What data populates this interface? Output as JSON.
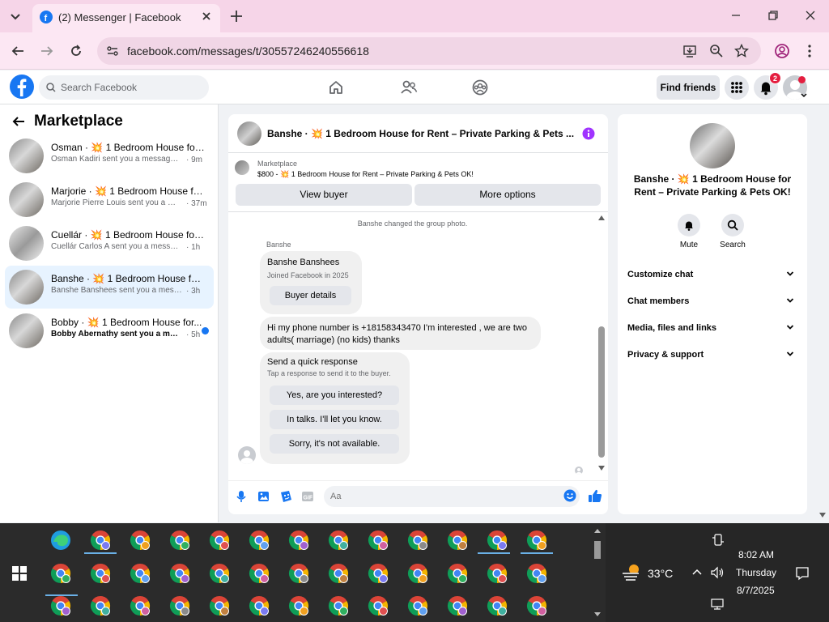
{
  "browser": {
    "tab_title": "(2) Messenger | Facebook",
    "url": "facebook.com/messages/t/30557246240556618"
  },
  "fbnav": {
    "search_placeholder": "Search Facebook",
    "find_friends": "Find friends",
    "notification_count": "2"
  },
  "sidebar": {
    "title": "Marketplace",
    "conversations": [
      {
        "name": "Osman · 💥 1 Bedroom House for ...",
        "preview": "Osman Kadiri sent you a message ab...",
        "time": "· 9m"
      },
      {
        "name": "Marjorie · 💥 1 Bedroom House for...",
        "preview": "Marjorie Pierre Louis sent you a mes...",
        "time": "· 37m"
      },
      {
        "name": "Cuellár · 💥 1 Bedroom House for ...",
        "preview": "Cuellár Carlos A sent you a message ...",
        "time": "· 1h"
      },
      {
        "name": "Banshe · 💥 1 Bedroom House for ...",
        "preview": "Banshe Banshees sent you a message ...",
        "time": "· 3h"
      },
      {
        "name": "Bobby · 💥 1 Bedroom House for...",
        "preview": "Bobby Abernathy sent you a mess...",
        "time": "· 5h"
      }
    ]
  },
  "chat": {
    "header_title": "Banshe · 💥 1 Bedroom House for Rent – Private Parking & Pets ...",
    "listing_label": "Marketplace",
    "listing_price": "$800 - 💥 1 Bedroom House for Rent – Private Parking & Pets OK!",
    "view_buyer": "View buyer",
    "more_options": "More options",
    "system_message": "Banshe changed the group photo.",
    "sender_name": "Banshe",
    "profile_card": {
      "name": "Banshe Banshees",
      "joined": "Joined Facebook in 2025",
      "button": "Buyer details"
    },
    "message_text": "Hi my phone number is +18158343470 I'm interested , we are two adults( marriage) (no kids) thanks",
    "quick_response": {
      "title": "Send a quick response",
      "subtitle": "Tap a response to send it to the buyer.",
      "options": [
        "Yes, are you interested?",
        "In talks. I'll let you know.",
        "Sorry, it's not available."
      ]
    },
    "input_placeholder": "Aa"
  },
  "info_panel": {
    "name": "Banshe · 💥 1 Bedroom House for Rent – Private Parking & Pets OK!",
    "mute": "Mute",
    "search": "Search",
    "sections": [
      "Customize chat",
      "Chat members",
      "Media, files and links",
      "Privacy & support"
    ]
  },
  "taskbar": {
    "temperature": "33°C",
    "time": "8:02 AM",
    "day": "Thursday",
    "date": "8/7/2025"
  },
  "colors": {
    "accent": "#1877f2",
    "chrome_pink": "#f6d5e8",
    "messenger_purple": "#a033ff"
  }
}
